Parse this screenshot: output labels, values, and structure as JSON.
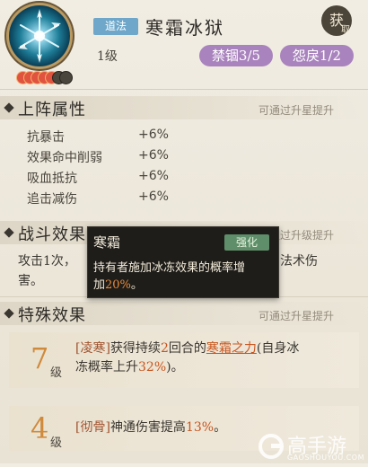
{
  "skill": {
    "type_tag": "道法",
    "name": "寒霜冰狱",
    "level": "1级",
    "get_button": {
      "main": "获",
      "sub": "取"
    },
    "stats_pills": [
      {
        "label": "禁锢3/5"
      },
      {
        "label": "怨戾1/2"
      }
    ],
    "stars": {
      "filled": 5,
      "total": 7,
      "filled_color": "#e0533f",
      "empty_color": "#4a453d"
    }
  },
  "sections": {
    "attributes": {
      "title": "上阵属性",
      "hint": "可通过升星提升",
      "items": [
        {
          "name": "抗暴击",
          "value": "+6%"
        },
        {
          "name": "效果命中削弱",
          "value": "+6%"
        },
        {
          "name": "吸血抵抗",
          "value": "+6%"
        },
        {
          "name": "追击减伤",
          "value": "+6%"
        }
      ]
    },
    "battle": {
      "title": "战斗效果",
      "hint": "可通过升级提升",
      "line1_left": "攻击1次，",
      "line1_right": "法术伤",
      "line2": "害。"
    },
    "special": {
      "title": "特殊效果",
      "hint": "可通过升星提升",
      "cards": [
        {
          "level_num": "7",
          "level_label": "级",
          "tag": "[凌寒]",
          "t1": "获得持续",
          "n1": "2",
          "t2": "回合的",
          "link": "寒霜之力",
          "t3": "(自身冰",
          "t4": "冻概率上升",
          "pct": "32%",
          "t5": ")。"
        },
        {
          "level_num": "4",
          "level_label": "级",
          "tag": "[彻骨]",
          "t1": "神通伤害提高",
          "pct": "13%",
          "t2": "。"
        }
      ]
    }
  },
  "tooltip": {
    "title": "寒霜",
    "tag": "强化",
    "body_1": "持有者施加冰冻效果的概率增",
    "body_2": "加",
    "pct": "20%",
    "body_3": "。"
  },
  "watermark": {
    "brand": "高手游",
    "url": "GAOSHOUYOU.COM"
  },
  "colors": {
    "accent_purple": "#a983bd",
    "type_tag_blue": "#6ea7c9",
    "highlight_orange": "#c8551e",
    "tooltip_bg": "#1f1d1a",
    "tooltip_tag_green": "#5f8f6a"
  }
}
